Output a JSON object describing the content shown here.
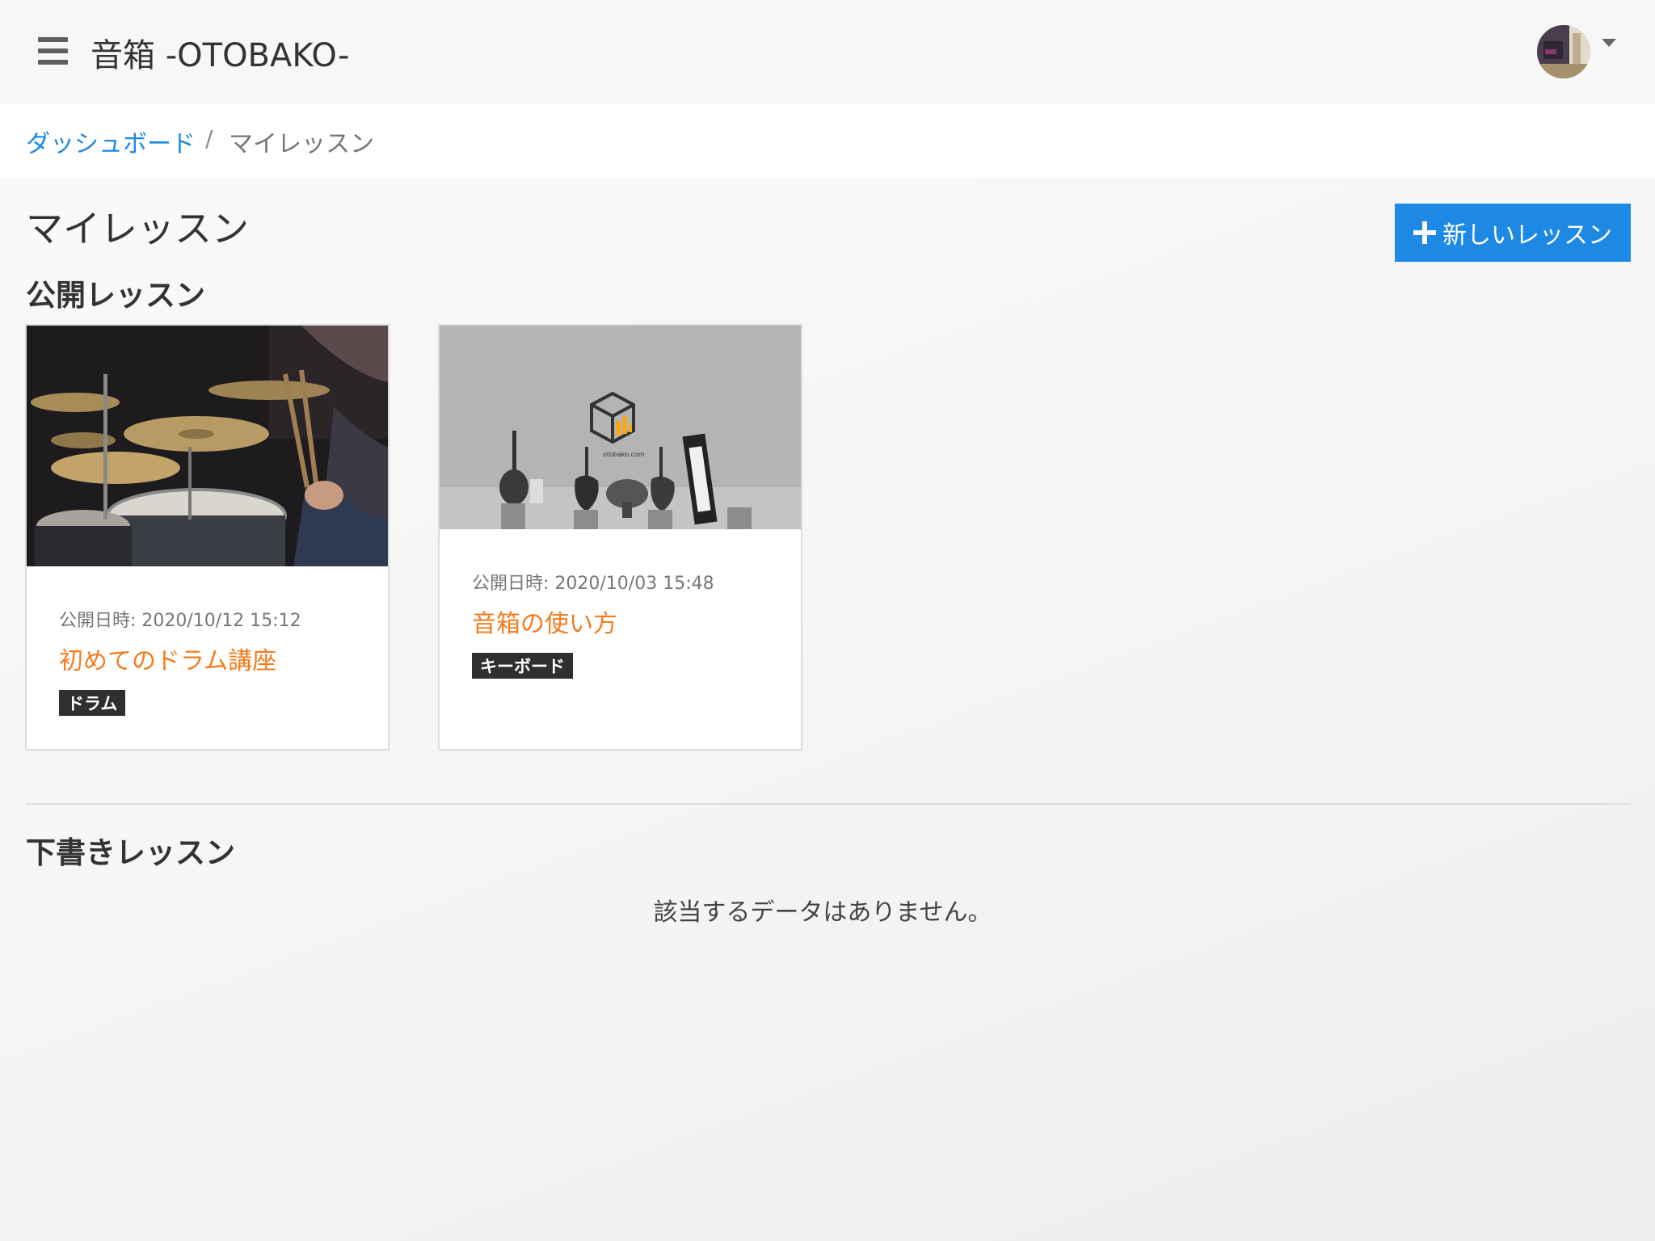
{
  "header": {
    "app_title": "音箱 -OTOBAKO-"
  },
  "breadcrumb": {
    "link": "ダッシュボード",
    "separator": "/",
    "current": "マイレッスン"
  },
  "page": {
    "title": "マイレッスン",
    "new_lesson_label": "新しいレッスン"
  },
  "sections": {
    "public_title": "公開レッスン",
    "draft_title": "下書きレッスン",
    "draft_empty": "該当するデータはありません。"
  },
  "lessons": [
    {
      "published": "公開日時: 2020/10/12 15:12",
      "title": "初めてのドラム講座",
      "tag": "ドラム"
    },
    {
      "published": "公開日時: 2020/10/03 15:48",
      "title": "音箱の使い方",
      "tag": "キーボード",
      "image_caption": "otobako.com"
    }
  ],
  "colors": {
    "accent_blue": "#1e88e5",
    "title_orange": "#f57c1f",
    "tag_bg": "#2f2f2f"
  }
}
